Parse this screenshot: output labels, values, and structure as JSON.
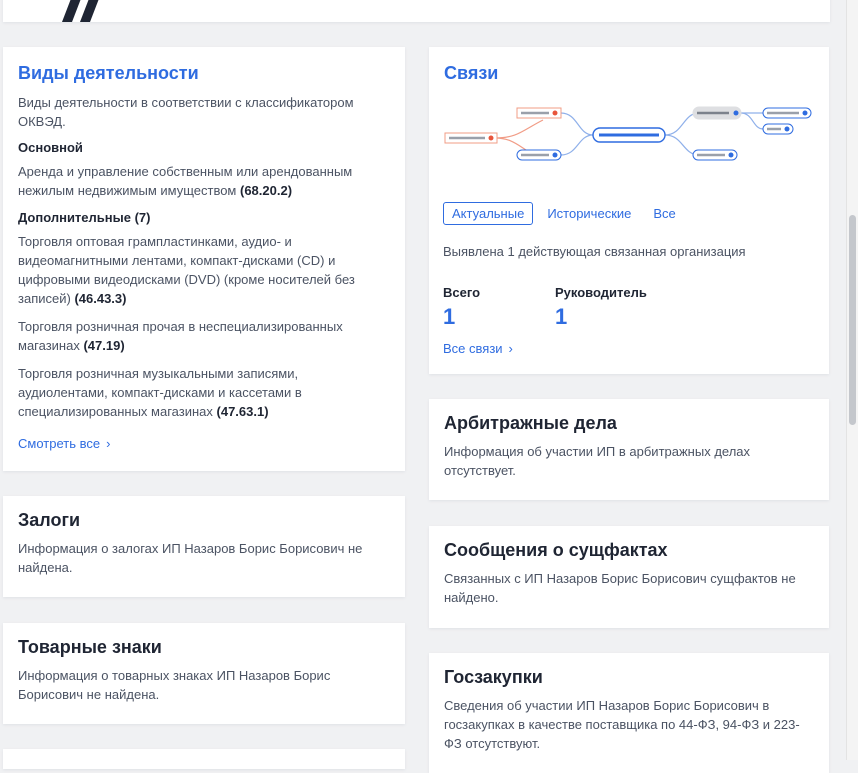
{
  "activity": {
    "title": "Виды деятельности",
    "intro": "Виды деятельности в соответствии с классификатором ОКВЭД.",
    "main_label": "Основной",
    "main_text": "Аренда и управление собственным или арендованным нежилым недвижимым имуществом",
    "main_code": "(68.20.2)",
    "extra_label": "Дополнительные (7)",
    "extra": [
      {
        "text": "Торговля оптовая грампластинками, аудио- и видеомагнитными лентами, компакт-дисками (CD) и цифровыми видеодисками (DVD) (кроме носителей без записей)",
        "code": "(46.43.3)"
      },
      {
        "text": "Торговля розничная прочая в неспециализированных магазинах",
        "code": "(47.19)"
      },
      {
        "text": "Торговля розничная музыкальными записями, аудиолентами, компакт-дисками и кассетами в специализированных магазинах",
        "code": "(47.63.1)"
      }
    ],
    "see_all": "Смотреть все",
    "chevron": "›"
  },
  "links": {
    "title": "Связи",
    "tabs": [
      "Актуальные",
      "Исторические",
      "Все"
    ],
    "found": "Выявлена 1 действующая связанная организация",
    "total_label": "Всего",
    "total_value": "1",
    "head_label": "Руководитель",
    "head_value": "1",
    "all_links": "Все связи",
    "chevron": "›"
  },
  "pledges": {
    "title": "Залоги",
    "text": "Информация о залогах ИП Назаров Борис Борисович не найдена."
  },
  "arbitration": {
    "title": "Арбитражные дела",
    "text": "Информация об участии ИП в арбитражных делах отсутствует."
  },
  "trademarks": {
    "title": "Товарные знаки",
    "text": "Информация о товарных знаках ИП Назаров Борис Борисович не найдена."
  },
  "facts": {
    "title": "Сообщения о сущфактах",
    "text": "Связанных с ИП Назаров Борис Борисович сущфактов не найдено."
  },
  "procurement": {
    "title": "Госзакупки",
    "text": "Сведения об участии ИП Назаров Борис Борисович в госзакупках в качестве поставщика по 44-ФЗ, 94-ФЗ и 223-ФЗ отсутствуют."
  }
}
